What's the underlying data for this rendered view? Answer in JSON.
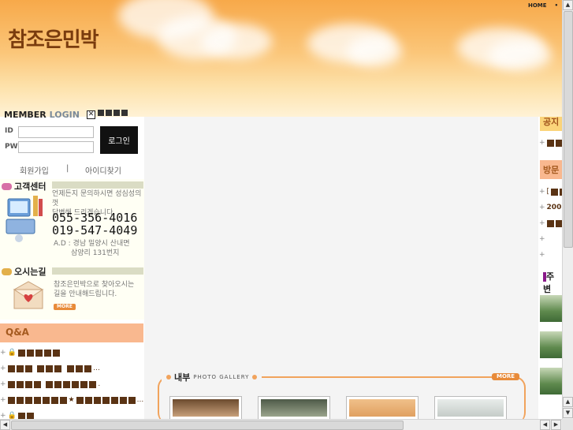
{
  "header": {
    "site_title": "참조은민박",
    "nav": [
      "HOME",
      "•"
    ]
  },
  "login": {
    "title_bold": "MEMBER",
    "title_light": "LOGIN",
    "id_label": "ID",
    "pw_label": "PW",
    "button_label": "로그인",
    "join_link": "회원가입",
    "separator": "|",
    "find_id_link": "아이디찾기"
  },
  "customer_center": {
    "title": "고객센터",
    "desc_line1": "언제든지 문의하시면 성심성의껏",
    "desc_line2": "답변해 드리겠습니다.",
    "phone1": "055-356-4016",
    "phone2": "019-547-4049",
    "addr_line1": "A.D : 경남 밀양시 산내면",
    "addr_line2": "삼양리 131번지"
  },
  "directions": {
    "title": "오시는길",
    "desc_line1": "참조은민박으로 찾아오시는",
    "desc_line2": "길을 안내해드립니다.",
    "more_label": "MORE"
  },
  "qna": {
    "title": "Q&A",
    "items": [
      {
        "text": "",
        "ellipsis": ""
      },
      {
        "text": "",
        "ellipsis": "..."
      },
      {
        "text": "",
        "ellipsis": "."
      },
      {
        "text": "★",
        "ellipsis": "..."
      },
      {
        "text": "",
        "ellipsis": ""
      }
    ]
  },
  "right": {
    "tab1": "공지",
    "tab2": "방문",
    "tab3": "주변",
    "items": [
      "",
      "[",
      "200",
      "",
      "",
      ""
    ]
  },
  "gallery": {
    "title": "내부",
    "subtitle": "PHOTO GALLERY",
    "more_label": "MORE"
  },
  "colors": {
    "accent": "#e88b3a",
    "brown": "#5a3314",
    "header_top": "#f7a94a"
  }
}
